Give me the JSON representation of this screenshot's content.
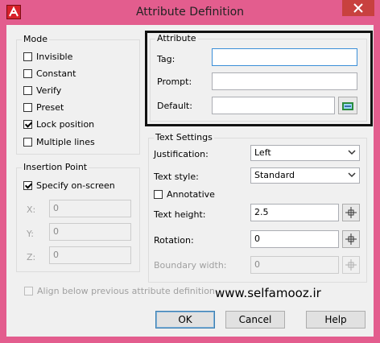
{
  "window": {
    "title": "Attribute Definition"
  },
  "mode": {
    "title": "Mode",
    "options": [
      {
        "label": "Invisible",
        "checked": false
      },
      {
        "label": "Constant",
        "checked": false
      },
      {
        "label": "Verify",
        "checked": false
      },
      {
        "label": "Preset",
        "checked": false
      },
      {
        "label": "Lock position",
        "checked": true
      },
      {
        "label": "Multiple lines",
        "checked": false
      }
    ]
  },
  "attribute": {
    "title": "Attribute",
    "tag_label": "Tag:",
    "tag_value": "",
    "prompt_label": "Prompt:",
    "prompt_value": "",
    "default_label": "Default:",
    "default_value": ""
  },
  "insertion_point": {
    "title": "Insertion Point",
    "specify_label": "Specify on-screen",
    "specify_checked": true,
    "x_label": "X:",
    "x_value": "0",
    "y_label": "Y:",
    "y_value": "0",
    "z_label": "Z:",
    "z_value": "0"
  },
  "text_settings": {
    "title": "Text Settings",
    "justification_label": "Justification:",
    "justification_value": "Left",
    "text_style_label": "Text style:",
    "text_style_value": "Standard",
    "annotative_label": "Annotative",
    "annotative_checked": false,
    "text_height_label": "Text height:",
    "text_height_value": "2.5",
    "rotation_label": "Rotation:",
    "rotation_value": "0",
    "boundary_label": "Boundary width:",
    "boundary_value": "0"
  },
  "align_below_label": "Align below previous attribute definition",
  "watermark": "www.selfamooz.ir",
  "buttons": {
    "ok": "OK",
    "cancel": "Cancel",
    "help": "Help"
  },
  "colors": {
    "frame": "#e35d8e",
    "client": "#f0f0f0",
    "close": "#c8413f",
    "focus": "#3b8fd8"
  }
}
